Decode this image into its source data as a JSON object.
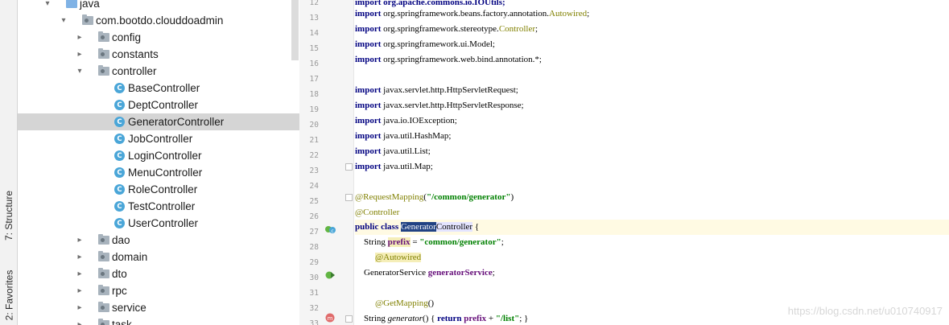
{
  "toolstrip": {
    "structure_label": "7: Structure",
    "favorites_label": "2: Favorites"
  },
  "tree": {
    "items": [
      {
        "label": "java",
        "kind": "folder-blue",
        "expanded": true
      },
      {
        "label": "com.bootdo.clouddoadmin",
        "kind": "package",
        "expanded": true
      },
      {
        "label": "config",
        "kind": "package",
        "expanded": false
      },
      {
        "label": "constants",
        "kind": "package",
        "expanded": false
      },
      {
        "label": "controller",
        "kind": "package",
        "expanded": true
      },
      {
        "label": "BaseController",
        "kind": "class"
      },
      {
        "label": "DeptController",
        "kind": "class"
      },
      {
        "label": "GeneratorController",
        "kind": "class",
        "selected": true
      },
      {
        "label": "JobController",
        "kind": "class"
      },
      {
        "label": "LoginController",
        "kind": "class"
      },
      {
        "label": "MenuController",
        "kind": "class"
      },
      {
        "label": "RoleController",
        "kind": "class"
      },
      {
        "label": "TestController",
        "kind": "class"
      },
      {
        "label": "UserController",
        "kind": "class"
      },
      {
        "label": "dao",
        "kind": "package",
        "expanded": false
      },
      {
        "label": "domain",
        "kind": "package",
        "expanded": false
      },
      {
        "label": "dto",
        "kind": "package",
        "expanded": false
      },
      {
        "label": "rpc",
        "kind": "package",
        "expanded": false
      },
      {
        "label": "service",
        "kind": "package",
        "expanded": false
      },
      {
        "label": "task",
        "kind": "package",
        "expanded": false
      }
    ]
  },
  "editor": {
    "line_numbers": [
      "12",
      "13",
      "14",
      "15",
      "16",
      "17",
      "18",
      "19",
      "20",
      "21",
      "22",
      "23",
      "24",
      "25",
      "26",
      "27",
      "28",
      "29",
      "30",
      "31",
      "32",
      "33"
    ],
    "lines": {
      "l12": "import org.apache.commons.io.IOUtils;",
      "l13_kw": "import",
      "l13_rest": " org.springframework.beans.factory.annotation.",
      "l13_ann": "Autowired",
      "l13_end": ";",
      "l14_kw": "import",
      "l14_rest": " org.springframework.stereotype.",
      "l14_ann": "Controller",
      "l14_end": ";",
      "l15_kw": "import",
      "l15_rest": " org.springframework.ui.Model;",
      "l16_kw": "import",
      "l16_rest": " org.springframework.web.bind.annotation.*;",
      "l18_kw": "import",
      "l18_rest": " javax.servlet.http.HttpServletRequest;",
      "l19_kw": "import",
      "l19_rest": " javax.servlet.http.HttpServletResponse;",
      "l20_kw": "import",
      "l20_rest": " java.io.IOException;",
      "l21_kw": "import",
      "l21_rest": " java.util.HashMap;",
      "l22_kw": "import",
      "l22_rest": " java.util.List;",
      "l23_kw": "import",
      "l23_rest": " java.util.Map;",
      "l25_ann": "@RequestMapping",
      "l25_open": "(",
      "l25_str": "\"/common/generator\"",
      "l25_close": ")",
      "l26_ann": "@Controller",
      "l27_kw": "public class ",
      "l27_sel": "Generator",
      "l27_word": "Controller",
      "l27_end": " {",
      "l28_type": "    String ",
      "l28_fld": "prefix",
      "l28_eq": " = ",
      "l28_str": "\"common/generator\"",
      "l28_end": ";",
      "l29_ann": "@Autowired",
      "l30_type": "    GeneratorService ",
      "l30_fld": "generatorService",
      "l30_end": ";",
      "l32_ann": "@GetMapping",
      "l32_end": "()",
      "l33_type": "    String ",
      "l33_name": "generator",
      "l33_mid": "() { ",
      "l33_kw": "return ",
      "l33_fld": "prefix",
      "l33_plus": " + ",
      "l33_str": "\"/list\"",
      "l33_end": "; }"
    }
  },
  "watermark": "https://blog.csdn.net/u010740917"
}
